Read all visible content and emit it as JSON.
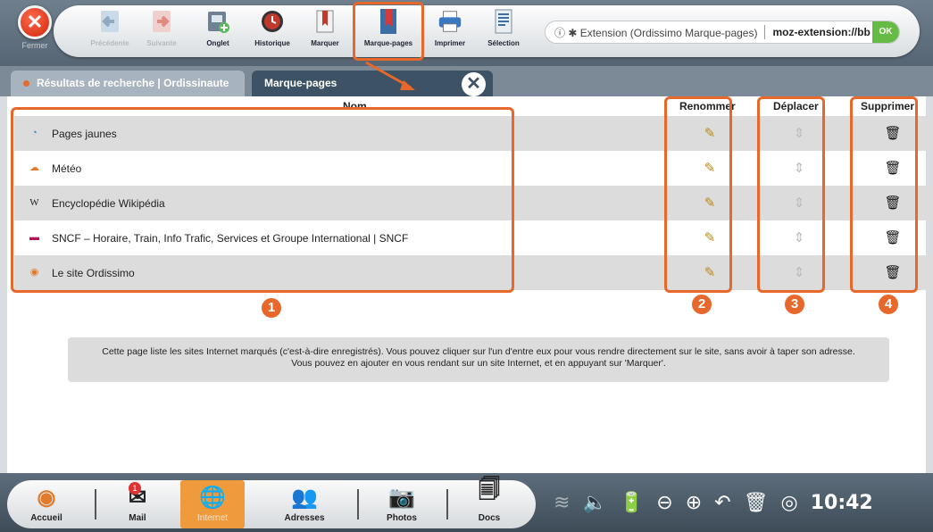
{
  "toolbar": {
    "close_label": "Fermer",
    "buttons": {
      "back": "Précédente",
      "forward": "Suivante",
      "tab": "Onglet",
      "history": "Historique",
      "mark": "Marquer",
      "bookmarks": "Marque-pages",
      "print": "Imprimer",
      "selection": "Sélection"
    },
    "urlbar": {
      "info": "ⓘ ✱ Extension (Ordissimo Marque-pages)",
      "url": "moz-extension://bb",
      "ok": "OK"
    }
  },
  "tabs": [
    {
      "label": "Résultats de recherche | Ordissinaute",
      "active": false
    },
    {
      "label": "Marque-pages",
      "active": true
    }
  ],
  "table": {
    "headers": {
      "name": "Nom",
      "rename": "Renommer",
      "move": "Déplacer",
      "delete": "Supprimer"
    },
    "rows": [
      {
        "name": "Pages jaunes",
        "favicon": "globe-icon"
      },
      {
        "name": "Météo",
        "favicon": "meteo-icon"
      },
      {
        "name": "Encyclopédie Wikipédia",
        "favicon": "wikipedia-icon"
      },
      {
        "name": "SNCF – Horaire, Train, Info Trafic, Services et Groupe International | SNCF",
        "favicon": "sncf-icon"
      },
      {
        "name": "Le site Ordissimo",
        "favicon": "ordissimo-icon"
      }
    ]
  },
  "callouts": [
    "1",
    "2",
    "3",
    "4"
  ],
  "info_text": "Cette page liste les sites Internet marqués (c'est-à-dire enregistrés). Vous pouvez cliquer sur l'un d'entre eux pour vous rendre directement sur le site, sans avoir à taper son adresse. Vous pouvez en ajouter en vous rendant sur un site Internet, et en appuyant sur 'Marquer'.",
  "taskbar": {
    "items": [
      "Accueil",
      "Mail",
      "Internet",
      "Adresses",
      "Photos",
      "Docs"
    ],
    "mail_badge": "1",
    "active": "Internet",
    "clock": "10:42"
  },
  "colors": {
    "accent": "#e8672b",
    "active_tab": "#3d5264",
    "internet_active": "#f09a3e"
  }
}
